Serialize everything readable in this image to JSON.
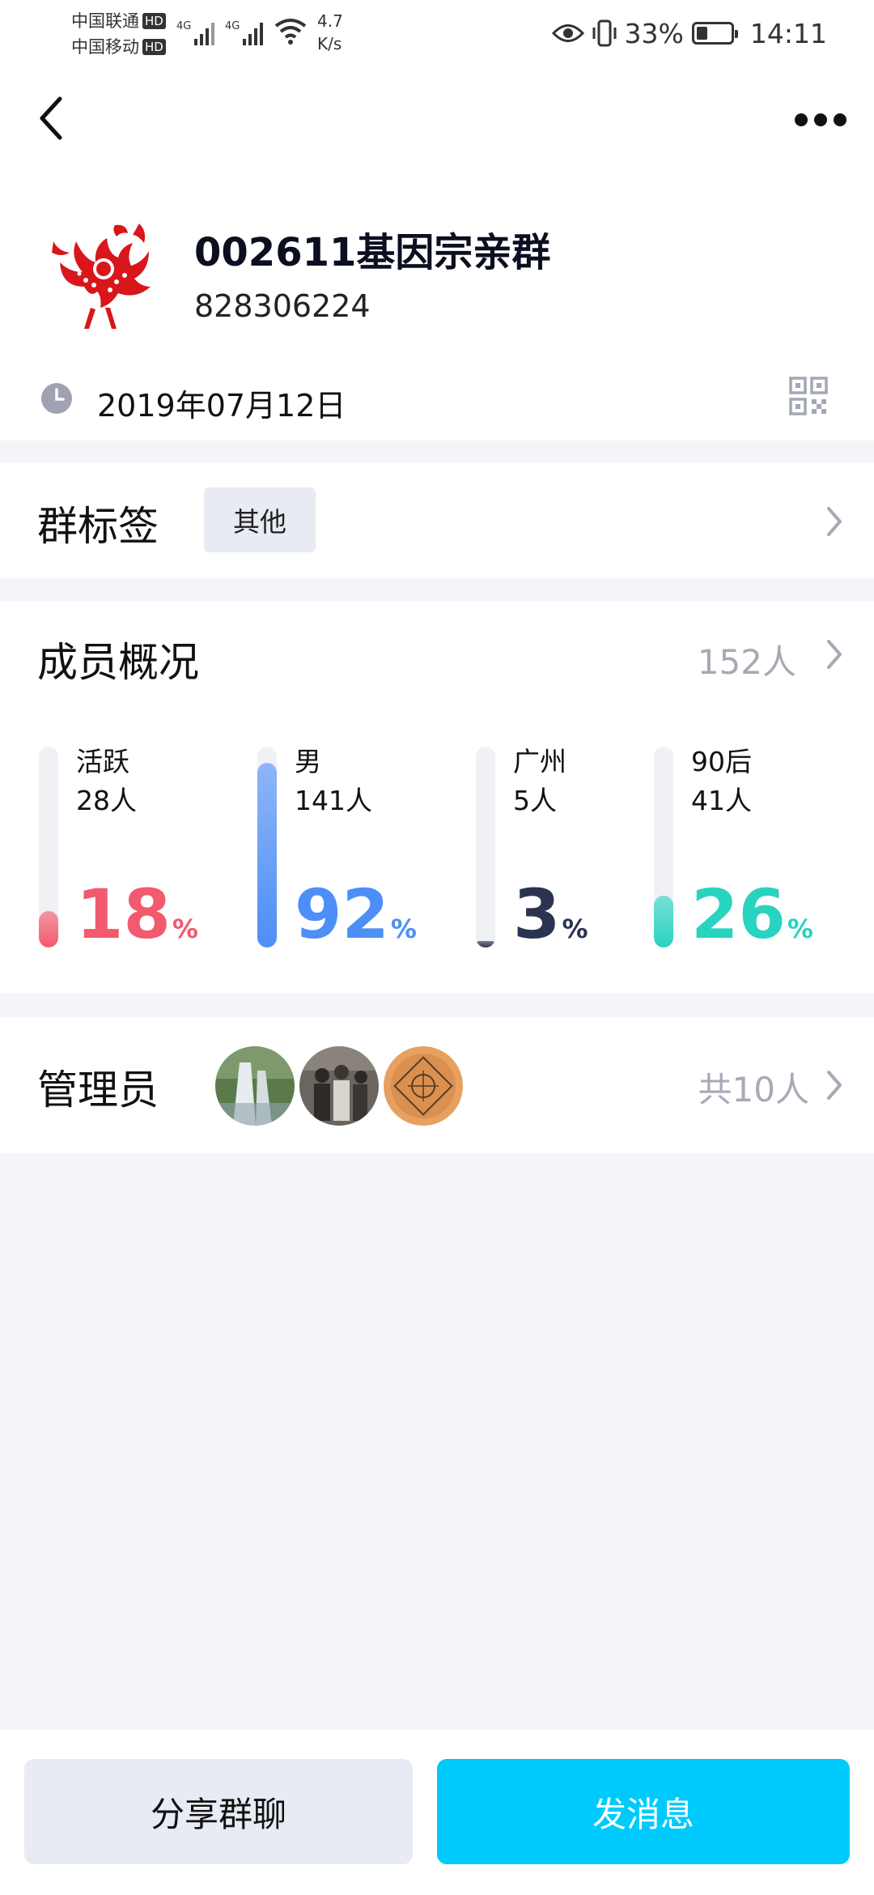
{
  "status_bar": {
    "carrier1": "中国联通",
    "carrier2": "中国移动",
    "hd_badge": "HD",
    "network1": "4G",
    "network2": "4G",
    "speed_value": "4.7",
    "speed_unit": "K/s",
    "battery_text": "33%",
    "battery_level": 0.33,
    "time": "14:11"
  },
  "header": {
    "group_name": "002611基因宗亲群",
    "group_id": "828306224",
    "date": "2019年07月12日"
  },
  "tags": {
    "title": "群标签",
    "tag": "其他"
  },
  "members": {
    "title": "成员概况",
    "count": "152人",
    "stats": [
      {
        "label": "活跃",
        "count": "28人",
        "percent": "18",
        "unit": "%",
        "fraction": 0.18,
        "color": "#f25a6e"
      },
      {
        "label": "男",
        "count": "141人",
        "percent": "92",
        "unit": "%",
        "fraction": 0.92,
        "color": "#4d8ef7"
      },
      {
        "label": "广州",
        "count": "5人",
        "percent": "3",
        "unit": "%",
        "fraction": 0.03,
        "color": "#2b3350"
      },
      {
        "label": "90后",
        "count": "41人",
        "percent": "26",
        "unit": "%",
        "fraction": 0.26,
        "color": "#28d3c0"
      }
    ]
  },
  "admins": {
    "title": "管理员",
    "count": "共10人"
  },
  "actions": {
    "share": "分享群聊",
    "send": "发消息"
  },
  "colors": {
    "accent": "#00cafc",
    "muted": "#a7aab5"
  }
}
